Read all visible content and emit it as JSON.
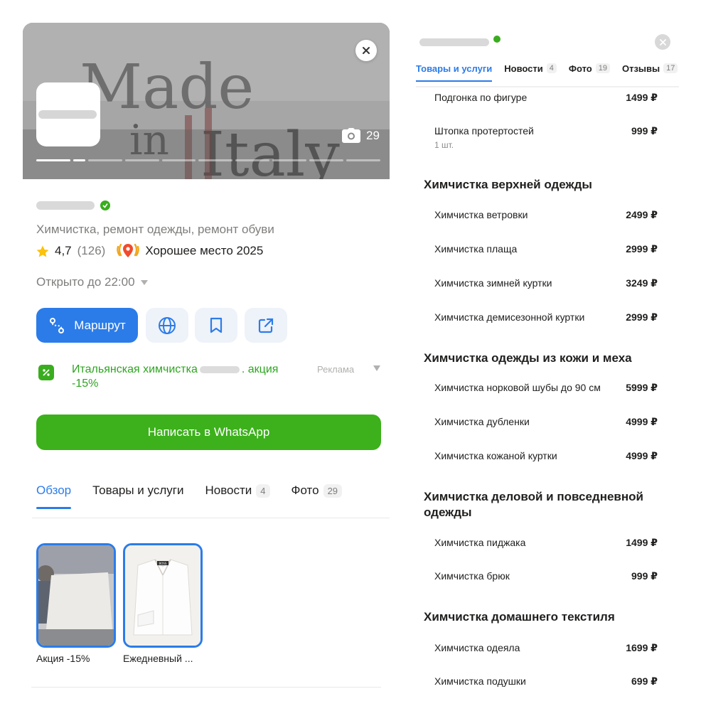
{
  "hero": {
    "photo_count": "29",
    "art_text_1": "Made",
    "art_text_2": "in",
    "art_text_3": "Italy"
  },
  "org": {
    "category": "Химчистка, ремонт одежды, ремонт обуви",
    "rating": "4,7",
    "reviews_count": "(126)",
    "award": "Хорошее место 2025",
    "hours": "Открыто до 22:00"
  },
  "actions": {
    "route_label": "Маршрут"
  },
  "ad": {
    "text_before": "Итальянская химчистка",
    "text_after": ". акция -15%",
    "label": "Реклама"
  },
  "whatsapp_label": "Написать в WhatsApp",
  "left_tabs": [
    {
      "label": "Обзор",
      "badge": ""
    },
    {
      "label": "Товары и услуги",
      "badge": ""
    },
    {
      "label": "Новости",
      "badge": "4"
    },
    {
      "label": "Фото",
      "badge": "29"
    }
  ],
  "promos": [
    {
      "caption": "Акция -15%"
    },
    {
      "caption": "Ежедневный ..."
    }
  ],
  "shirt_label": "BOSS",
  "right_tabs": [
    {
      "label": "Товары и услуги",
      "badge": ""
    },
    {
      "label": "Новости",
      "badge": "4"
    },
    {
      "label": "Фото",
      "badge": "19"
    },
    {
      "label": "Отзывы",
      "badge": "17"
    }
  ],
  "price_list": {
    "items_top": [
      {
        "name": "Подгонка по фигуре",
        "price": "1499 ₽"
      },
      {
        "name": "Штопка протертостей",
        "price": "999 ₽",
        "sub": "1 шт."
      }
    ],
    "categories": [
      {
        "title": "Химчистка верхней одежды",
        "items": [
          {
            "name": "Химчистка ветровки",
            "price": "2499 ₽"
          },
          {
            "name": "Химчистка плаща",
            "price": "2999 ₽"
          },
          {
            "name": "Химчистка зимней куртки",
            "price": "3249 ₽"
          },
          {
            "name": "Химчистка демисезонной куртки",
            "price": "2999 ₽"
          }
        ]
      },
      {
        "title": "Химчистка одежды из кожи и меха",
        "items": [
          {
            "name": "Химчистка норковой шубы до 90 см",
            "price": "5999 ₽"
          },
          {
            "name": "Химчистка дубленки",
            "price": "4999 ₽"
          },
          {
            "name": "Химчистка кожаной куртки",
            "price": "4999 ₽"
          }
        ]
      },
      {
        "title": "Химчистка деловой и повседневной одежды",
        "items": [
          {
            "name": "Химчистка пиджака",
            "price": "1499 ₽"
          },
          {
            "name": "Химчистка брюк",
            "price": "999 ₽"
          }
        ]
      },
      {
        "title": "Химчистка домашнего текстиля",
        "items": [
          {
            "name": "Химчистка одеяла",
            "price": "1699 ₽"
          },
          {
            "name": "Химчистка подушки",
            "price": "699 ₽"
          }
        ]
      }
    ]
  },
  "colors": {
    "accent_blue": "#2b7ce9",
    "whatsapp_green": "#3cb11b",
    "ad_green": "#2da520",
    "muted_text": "#7f7e7c"
  }
}
